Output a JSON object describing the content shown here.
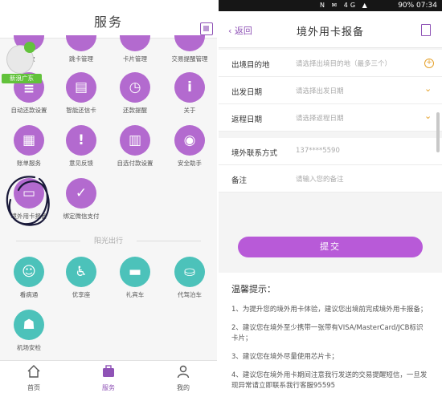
{
  "left": {
    "header": {
      "title": "服务"
    },
    "partial_row": [
      "动效",
      "跳卡管理",
      "卡片管理",
      "交易提醒管理"
    ],
    "grid": [
      {
        "label": "自动还款设置",
        "icon": "stack-gear-icon",
        "glyph": "≣"
      },
      {
        "label": "智能还信卡",
        "icon": "card-stack-icon",
        "glyph": "▤"
      },
      {
        "label": "还款提醒",
        "icon": "alarm-clock-icon",
        "glyph": "◷"
      },
      {
        "label": "关于",
        "icon": "info-icon",
        "glyph": "i"
      },
      {
        "label": "账单服务",
        "icon": "bill-icon",
        "glyph": "▦"
      },
      {
        "label": "意见反馈",
        "icon": "feedback-icon",
        "glyph": "!"
      },
      {
        "label": "自选付款设置",
        "icon": "document-icon",
        "glyph": "▥"
      },
      {
        "label": "安全助手",
        "icon": "shield-icon",
        "glyph": "◉"
      },
      {
        "label": "境外用卡报备",
        "icon": "card-report-icon",
        "glyph": "▭"
      },
      {
        "label": "绑定微信支付",
        "icon": "wechat-pay-icon",
        "glyph": "✓"
      }
    ],
    "floating": {
      "label": "新浪广东"
    },
    "divider_text": "阳光出行",
    "travel": [
      {
        "label": "看病通",
        "icon": "doctor-icon",
        "glyph": "☺"
      },
      {
        "label": "优享座",
        "icon": "seat-icon",
        "glyph": "♿"
      },
      {
        "label": "礼宾车",
        "icon": "car-icon",
        "glyph": "▬"
      },
      {
        "label": "代驾泊车",
        "icon": "parking-icon",
        "glyph": "⛀"
      },
      {
        "label": "机场安检",
        "icon": "security-gate-icon",
        "glyph": "☗"
      }
    ],
    "tabbar": [
      {
        "label": "首页",
        "icon": "home-icon",
        "active": false
      },
      {
        "label": "服务",
        "icon": "briefcase-icon",
        "active": true
      },
      {
        "label": "我的",
        "icon": "person-icon",
        "active": false
      }
    ]
  },
  "right": {
    "status": {
      "icons": "N ✉ 4G ▲",
      "text": "90%  07:34"
    },
    "header": {
      "back": "返回",
      "title": "境外用卡报备"
    },
    "fields": [
      {
        "label": "出境目的地",
        "placeholder": "请选择出境目的地（最多三个）",
        "control": "add"
      },
      {
        "label": "出发日期",
        "placeholder": "请选择出发日期",
        "control": "dropdown"
      },
      {
        "label": "返程日期",
        "placeholder": "请选择返程日期",
        "control": "dropdown"
      }
    ],
    "contact": {
      "label": "境外联系方式",
      "value": "137****5590"
    },
    "remark": {
      "label": "备注",
      "placeholder": "请输入您的备注"
    },
    "submit": "提交",
    "tips_title": "温馨提示：",
    "tips": [
      "1、为提升您的境外用卡体验，建议您出境前完成境外用卡报备；",
      "2、建议您在境外至少携带一张带有VISA/MasterCard/JCB标识卡片；",
      "3、建议您在境外尽量使用芯片卡；",
      "4、建议您在境外用卡期间注意我行发送的交易提醒短信，一旦发现异常请立即联系我行客服95595"
    ]
  }
}
